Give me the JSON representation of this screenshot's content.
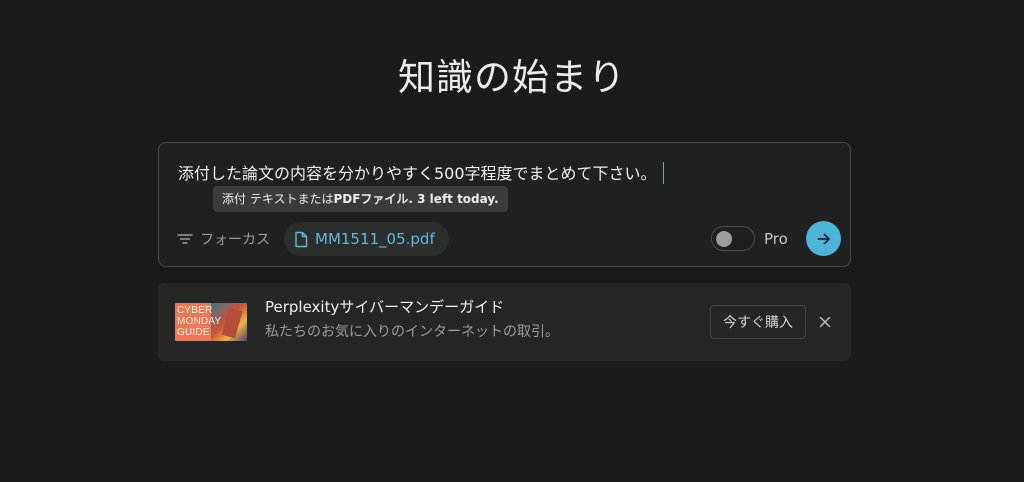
{
  "main": {
    "title": "知識の始まり"
  },
  "composer": {
    "query_text": "添付した論文の内容を分かりやすく500字程度でまとめて下さい。",
    "tooltip": {
      "prefix": "添付 テキストまたは",
      "bold": "PDFファイル. 3 left today."
    },
    "focus_label": "フォーカス",
    "attachment_name": "MM1511_05.pdf",
    "pro_label": "Pro",
    "pro_enabled": false,
    "accent_color": "#4fb4d8"
  },
  "banner": {
    "thumbnail_text": [
      "CYBER",
      "MONDAY",
      "GUIDE"
    ],
    "title": "Perplexityサイバーマンデーガイド",
    "subtitle": "私たちのお気に入りのインターネットの取引。",
    "buy_label": "今すぐ購入"
  },
  "icons": {
    "focus": "filter-lines-icon",
    "attachment": "file-icon",
    "submit": "arrow-right-icon",
    "close": "close-icon"
  }
}
